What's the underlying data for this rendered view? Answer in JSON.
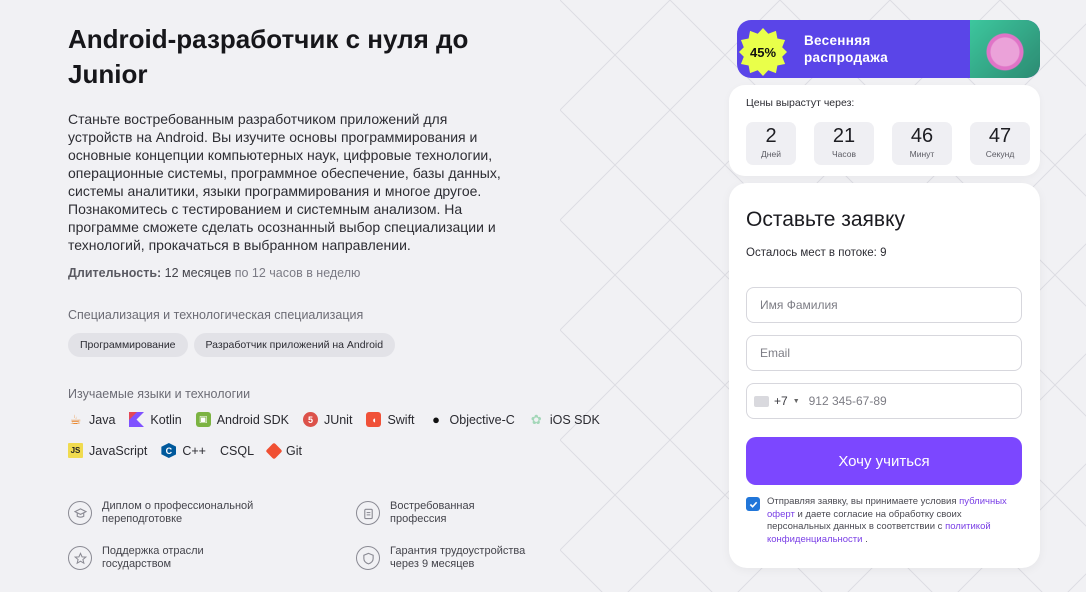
{
  "course": {
    "title": "Android-разработчик с нуля до Junior",
    "description": "Станьте востребованным разработчиком приложений для устройств на Android. Вы изучите основы программирования и основные концепции компьютерных наук, цифровые технологии, операционные системы, программное обеспечение, базы данных, системы аналитики, языки программирования и многое другое. Познакомитесь с тестированием и системным анализом. На программе сможете сделать осознанный выбор специализации и технологий, прокачаться в выбранном направлении.",
    "duration_label": "Длительность:",
    "duration_value": "12 месяцев",
    "duration_rate": "по 12 часов в неделю"
  },
  "specialization": {
    "heading": "Специализация и технологическая специализация",
    "chips": [
      "Программирование",
      "Разработчик приложений на Android"
    ]
  },
  "technologies": {
    "heading": "Изучаемые языки и технологии",
    "items": [
      {
        "name": "Java",
        "icon": "java-icon",
        "color": "#e76f00"
      },
      {
        "name": "Kotlin",
        "icon": "kotlin-icon",
        "color": "#7f52ff"
      },
      {
        "name": "Android SDK",
        "icon": "android-icon",
        "color": "#7cb342"
      },
      {
        "name": "JUnit",
        "icon": "junit-icon",
        "color": "#dc524a"
      },
      {
        "name": "Swift",
        "icon": "swift-icon",
        "color": "#f05138"
      },
      {
        "name": "Objective-C",
        "icon": "apple-icon",
        "color": "#111111"
      },
      {
        "name": "iOS SDK",
        "icon": "ios-sdk-icon",
        "color": "#a3d7b8"
      },
      {
        "name": "JavaScript",
        "icon": "javascript-icon",
        "color": "#f0db4f"
      },
      {
        "name": "C++",
        "icon": "cpp-icon",
        "color": "#00599c"
      },
      {
        "name": "CSQL",
        "icon": "",
        "color": ""
      },
      {
        "name": "Git",
        "icon": "git-icon",
        "color": "#f05033"
      }
    ]
  },
  "features": [
    {
      "text": "Диплом о профессиональной\nпереподготовке",
      "icon": "graduation-cap-icon"
    },
    {
      "text": "Востребованная\nпрофессия",
      "icon": "clipboard-icon"
    },
    {
      "text": "Поддержка отрасли\nгосударством",
      "icon": "star-icon"
    },
    {
      "text": "Гарантия трудоустройства\nчерез 9 месяцев",
      "icon": "shield-icon"
    }
  ],
  "promo": {
    "discount": "45%",
    "text_line1": "Весенняя",
    "text_line2": "распродажа"
  },
  "timer": {
    "heading": "Цены вырастут через:",
    "units": [
      {
        "value": "2",
        "label": "Дней"
      },
      {
        "value": "21",
        "label": "Часов"
      },
      {
        "value": "46",
        "label": "Минут"
      },
      {
        "value": "47",
        "label": "Секунд"
      }
    ]
  },
  "form": {
    "heading": "Оставьте заявку",
    "spots_label": "Осталось мест в потоке:",
    "spots_value": "9",
    "name_placeholder": "Имя Фамилия",
    "email_placeholder": "Email",
    "phone_code": "+7",
    "phone_placeholder": "912 345-67-89",
    "submit_label": "Хочу учиться",
    "consent": {
      "part1": "Отправляя заявку, вы принимаете условия",
      "link1": "публичных оферт",
      "part2": "и даете согласие на обработку своих персональных данных в соответствии с",
      "link2": "политикой конфиденциальности",
      "part3": "."
    }
  },
  "colors": {
    "accent": "#7c47ff",
    "banner": "#5a45e8",
    "badge": "#e9ff4a",
    "checkbox": "#2176d9"
  }
}
